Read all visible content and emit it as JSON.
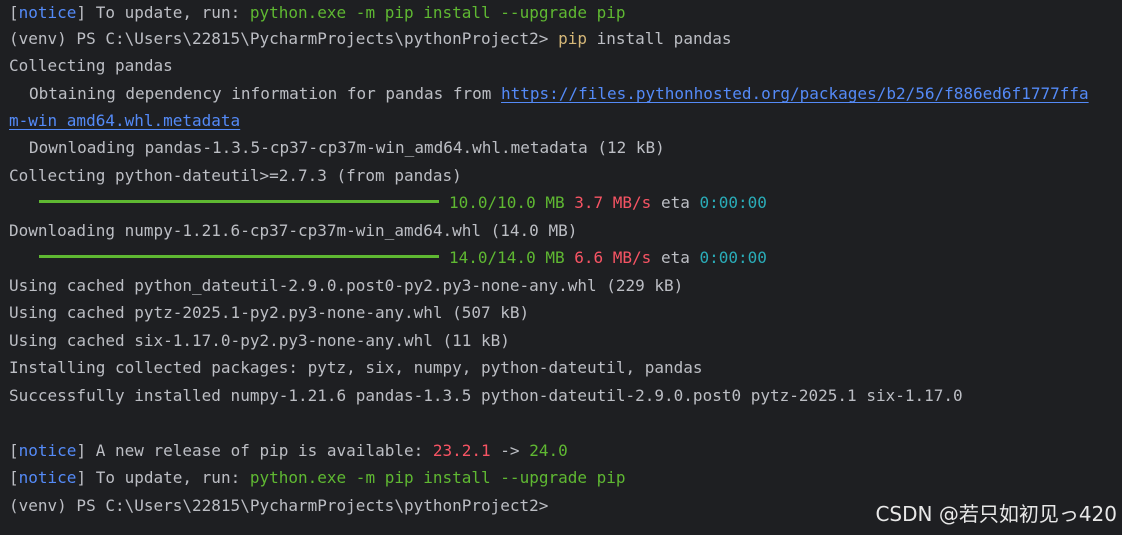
{
  "lines": {
    "l1": {
      "bracket_open": "[",
      "notice": "notice",
      "bracket_close": "]",
      "text": " To update, run: ",
      "command": "python.exe -m pip install --upgrade pip"
    },
    "l2": {
      "prompt": "(venv) PS C:\\Users\\22815\\PycharmProjects\\pythonProject2> ",
      "cmd_pip": "pip",
      "cmd_rest": " install pandas"
    },
    "l3": {
      "text": "Collecting pandas"
    },
    "l4": {
      "text": "Obtaining dependency information for pandas from ",
      "link": "https://files.pythonhosted.org/packages/b2/56/f886ed6f1777ffa"
    },
    "l5": {
      "link": "m-win_amd64.whl.metadata"
    },
    "l6": {
      "text": "Downloading pandas-1.3.5-cp37-cp37m-win_amd64.whl.metadata (12 kB)"
    },
    "l7": {
      "text": "Collecting python-dateutil>=2.7.3 (from pandas)"
    },
    "l8": {
      "size": "10.0/10.0 MB",
      "speed": "3.7 MB/s",
      "eta_label": "eta",
      "eta": "0:00:00"
    },
    "l9": {
      "text": "Downloading numpy-1.21.6-cp37-cp37m-win_amd64.whl (14.0 MB)"
    },
    "l10": {
      "size": "14.0/14.0 MB",
      "speed": "6.6 MB/s",
      "eta_label": "eta",
      "eta": "0:00:00"
    },
    "l11": {
      "text": "Using cached python_dateutil-2.9.0.post0-py2.py3-none-any.whl (229 kB)"
    },
    "l12": {
      "text": "Using cached pytz-2025.1-py2.py3-none-any.whl (507 kB)"
    },
    "l13": {
      "text": "Using cached six-1.17.0-py2.py3-none-any.whl (11 kB)"
    },
    "l14": {
      "text": "Installing collected packages: pytz, six, numpy, python-dateutil, pandas"
    },
    "l15": {
      "text": "Successfully installed numpy-1.21.6 pandas-1.3.5 python-dateutil-2.9.0.post0 pytz-2025.1 six-1.17.0"
    },
    "l16": {
      "bracket_open": "[",
      "notice": "notice",
      "bracket_close": "]",
      "text": " A new release of pip is available: ",
      "old_version": "23.2.1",
      "arrow": " -> ",
      "new_version": "24.0"
    },
    "l17": {
      "bracket_open": "[",
      "notice": "notice",
      "bracket_close": "]",
      "text": " To update, run: ",
      "command": "python.exe -m pip install --upgrade pip"
    },
    "l18": {
      "prompt": "(venv) PS C:\\Users\\22815\\PycharmProjects\\pythonProject2>"
    }
  },
  "watermark": "CSDN @若只如初见っ420",
  "colors": {
    "background": "#1e1f22",
    "foreground": "#bcbec4",
    "notice": "#548af7",
    "green": "#5fb832",
    "red": "#f75464",
    "cyan": "#2aacb8",
    "yellow": "#d5b778"
  }
}
